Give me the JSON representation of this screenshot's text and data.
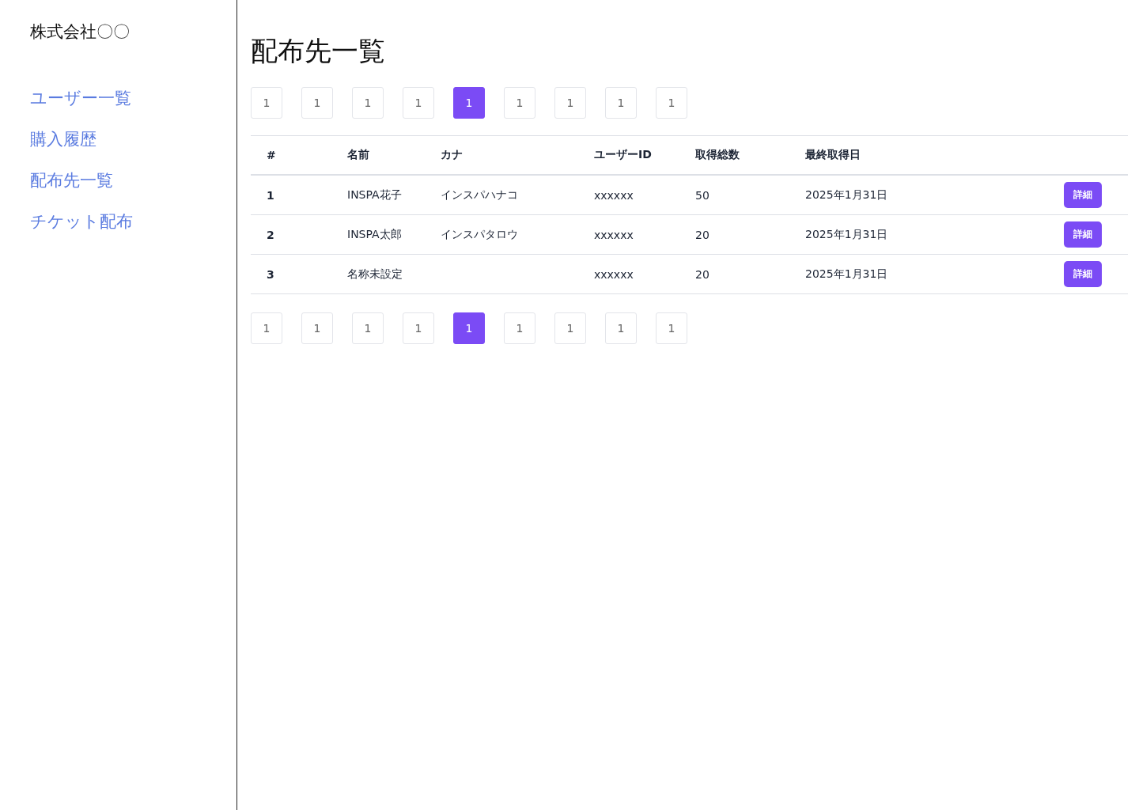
{
  "sidebar": {
    "company": "株式会社〇〇",
    "items": [
      {
        "label": "ユーザー一覧"
      },
      {
        "label": "購入履歴"
      },
      {
        "label": "配布先一覧"
      },
      {
        "label": "チケット配布"
      }
    ]
  },
  "page_title": "配布先一覧",
  "pagination_top": [
    {
      "label": "1",
      "selected": false
    },
    {
      "label": "1",
      "selected": false
    },
    {
      "label": "1",
      "selected": false
    },
    {
      "label": "1",
      "selected": false
    },
    {
      "label": "1",
      "selected": true
    },
    {
      "label": "1",
      "selected": false
    },
    {
      "label": "1",
      "selected": false
    },
    {
      "label": "1",
      "selected": false
    },
    {
      "label": "1",
      "selected": false
    }
  ],
  "table": {
    "columns": [
      "#",
      "名前",
      "カナ",
      "ユーザーID",
      "取得総数",
      "最終取得日"
    ],
    "rows": [
      {
        "no": "1",
        "name": "INSPA花子",
        "kana": "インスパハナコ",
        "user_id": "xxxxxx",
        "total": "50",
        "last_date": "2025年1月31日",
        "action": "詳細"
      },
      {
        "no": "2",
        "name": "INSPA太郎",
        "kana": "インスパタロウ",
        "user_id": "xxxxxx",
        "total": "20",
        "last_date": "2025年1月31日",
        "action": "詳細"
      },
      {
        "no": "3",
        "name": "名称未設定",
        "user_id": "xxxxxx",
        "total": "20",
        "last_date": "2025年1月31日",
        "action": "詳細"
      }
    ]
  },
  "pagination_bottom": [
    {
      "label": "1",
      "selected": false
    },
    {
      "label": "1",
      "selected": false
    },
    {
      "label": "1",
      "selected": false
    },
    {
      "label": "1",
      "selected": false
    },
    {
      "label": "1",
      "selected": true
    },
    {
      "label": "1",
      "selected": false
    },
    {
      "label": "1",
      "selected": false
    },
    {
      "label": "1",
      "selected": false
    },
    {
      "label": "1",
      "selected": false
    }
  ]
}
